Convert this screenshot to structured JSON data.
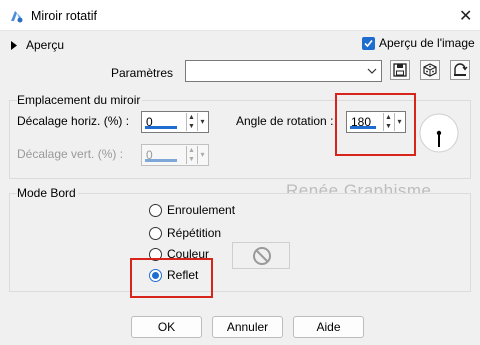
{
  "window": {
    "title": "Miroir rotatif",
    "close_glyph": "✕"
  },
  "header": {
    "preview_toggle_label": "Aperçu",
    "preview_image_label": "Aperçu de l'image",
    "preview_image_checked": true,
    "params_label": "Paramètres",
    "params_value": ""
  },
  "mirror_group": {
    "title": "Emplacement du miroir",
    "h_offset_label": "Décalage horiz. (%) :",
    "h_offset_value": "0",
    "v_offset_label": "Décalage vert. (%) :",
    "v_offset_value": "0",
    "angle_label": "Angle de rotation :",
    "angle_value": "180",
    "angle_dial_fraction": 0.5
  },
  "edge_group": {
    "title": "Mode Bord",
    "options": [
      {
        "label": "Enroulement",
        "checked": false
      },
      {
        "label": "Répétition",
        "checked": false
      },
      {
        "label": "Couleur",
        "checked": false
      },
      {
        "label": "Reflet",
        "checked": true
      }
    ]
  },
  "watermark": "Renée Graphisme",
  "buttons": {
    "ok": "OK",
    "cancel": "Annuler",
    "help": "Aide"
  },
  "colors": {
    "accent": "#1f6cd1",
    "highlight": "#d7251c"
  }
}
